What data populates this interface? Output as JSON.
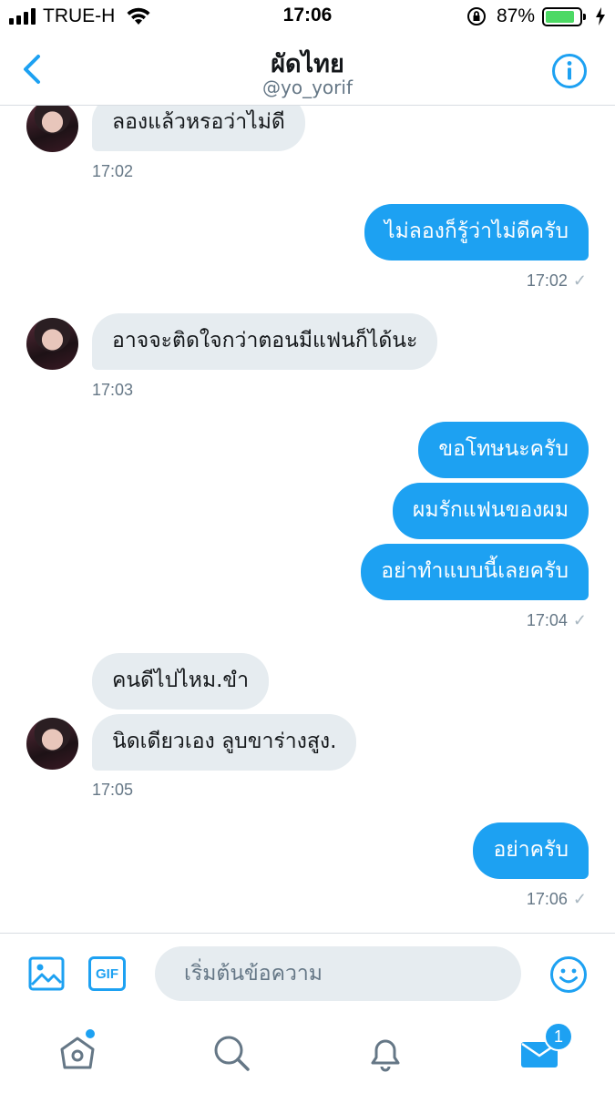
{
  "status_bar": {
    "carrier": "TRUE-H",
    "time": "17:06",
    "battery_percent": "87%",
    "battery_level": 0.87,
    "icons": [
      "signal-icon",
      "wifi-icon",
      "orientation-lock-icon",
      "battery-icon",
      "charging-bolt-icon"
    ]
  },
  "header": {
    "title": "ผัดไทย",
    "handle": "@yo_yorif",
    "back_icon": "chevron-left-icon",
    "info_icon": "info-icon"
  },
  "messages": [
    {
      "id": "m1",
      "side": "in",
      "text": "ลองแล้วหรอว่าไม่ดี"
    },
    {
      "id": "t1",
      "kind": "timestamp",
      "text": "17:02"
    },
    {
      "id": "m2",
      "side": "out",
      "text": "ไม่ลองก็รู้ว่าไม่ดีครับ"
    },
    {
      "id": "t2",
      "kind": "timestamp",
      "text": "17:02",
      "check": "✓"
    },
    {
      "id": "m3",
      "side": "in",
      "text": "อาจจะติดใจกว่าตอนมีแฟนก็ได้นะ"
    },
    {
      "id": "t3",
      "kind": "timestamp",
      "text": "17:03"
    },
    {
      "id": "m4",
      "side": "out",
      "text": "ขอโทษนะครับ"
    },
    {
      "id": "m5",
      "side": "out",
      "text": "ผมรักแฟนของผม"
    },
    {
      "id": "m6",
      "side": "out",
      "text": "อย่าทำแบบนี้เลยครับ"
    },
    {
      "id": "t4",
      "kind": "timestamp",
      "text": "17:04",
      "check": "✓"
    },
    {
      "id": "m7",
      "side": "in",
      "text": "คนดีไปไหม.ขำ"
    },
    {
      "id": "m8",
      "side": "in",
      "text": "นิดเดียวเอง ลูบขาร่างสูง."
    },
    {
      "id": "t5",
      "kind": "timestamp",
      "text": "17:05"
    },
    {
      "id": "m9",
      "side": "out",
      "text": "อย่าครับ"
    },
    {
      "id": "t6",
      "kind": "timestamp",
      "text": "17:06",
      "check": "✓"
    }
  ],
  "composer": {
    "placeholder": "เริ่มต้นข้อความ",
    "gif_label": "GIF",
    "icons": [
      "photo-icon",
      "gif-icon",
      "emoji-icon"
    ]
  },
  "tab_bar": {
    "items": [
      "home-icon",
      "search-icon",
      "notifications-icon",
      "messages-icon"
    ],
    "messages_badge": "1"
  },
  "colors": {
    "accent": "#1da1f2",
    "incoming_bubble": "#e6ecf0",
    "secondary_text": "#657786",
    "battery": "#4cd964"
  }
}
